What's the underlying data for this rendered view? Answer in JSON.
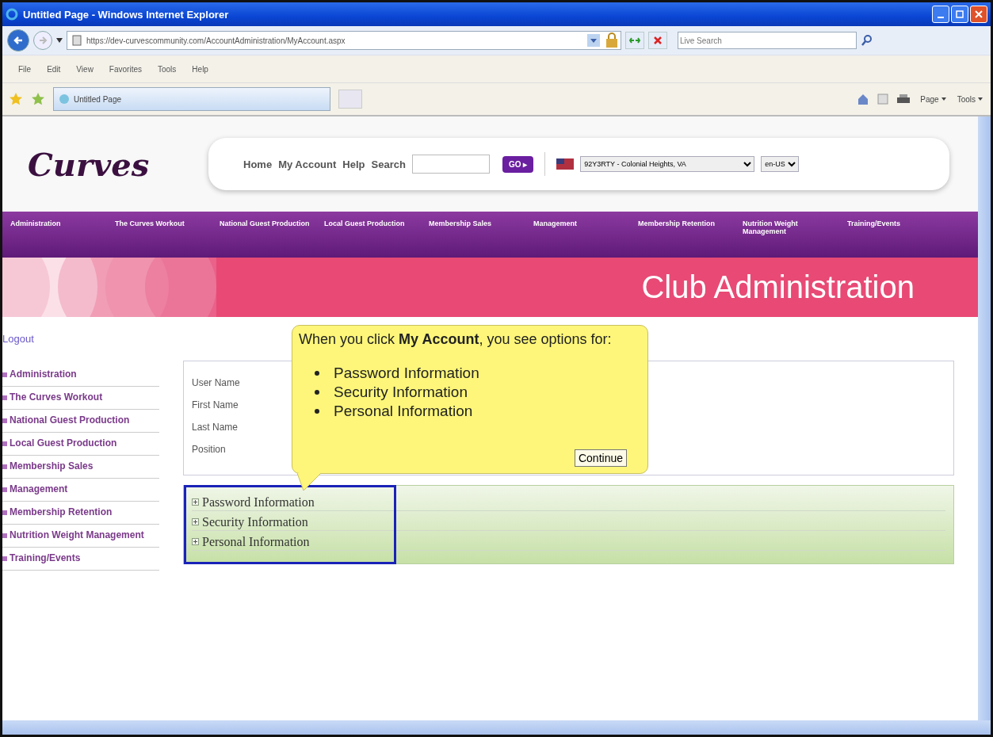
{
  "window": {
    "title": "Untitled Page - Windows Internet Explorer"
  },
  "address_bar": {
    "url": "https://dev-curvescommunity.com/AccountAdministration/MyAccount.aspx"
  },
  "search_box": {
    "placeholder": "Live Search"
  },
  "menu_bar": [
    "File",
    "Edit",
    "View",
    "Favorites",
    "Tools",
    "Help"
  ],
  "tab": {
    "title": "Untitled Page"
  },
  "command_bar": [
    "Page",
    "Tools"
  ],
  "page": {
    "logo": "Curves",
    "top_links": [
      "Home",
      "My Account",
      "Help"
    ],
    "search_label": "Search",
    "go_button": "GO ▸",
    "club_select": "92Y3RTY - Colonial Heights, VA",
    "language_select": "en-US",
    "nav_tabs": [
      "Administration",
      "The Curves Workout",
      "National Guest Production",
      "Local Guest Production",
      "Membership Sales",
      "Management",
      "Membership Retention",
      "Nutrition Weight Management",
      "Training/Events"
    ],
    "banner_title": "Club Administration",
    "logout": "Logout",
    "sidebar": [
      "Administration",
      "The Curves Workout",
      "National Guest Production",
      "Local Guest Production",
      "Membership Sales",
      "Management",
      "Membership Retention",
      "Nutrition Weight Management",
      "Training/Events"
    ],
    "form_fields": [
      "User Name",
      "First Name",
      "Last Name",
      "Position"
    ],
    "sections": [
      {
        "label": "Password Information",
        "expanded": false
      },
      {
        "label": "Security Information",
        "expanded": false
      },
      {
        "label": "Personal Information",
        "expanded": false
      }
    ]
  },
  "callout": {
    "text": "When you click **My Account**, you see options for:",
    "bullets": [
      "Password Information",
      "Security Information",
      "Personal Information"
    ],
    "button": "Continue"
  }
}
